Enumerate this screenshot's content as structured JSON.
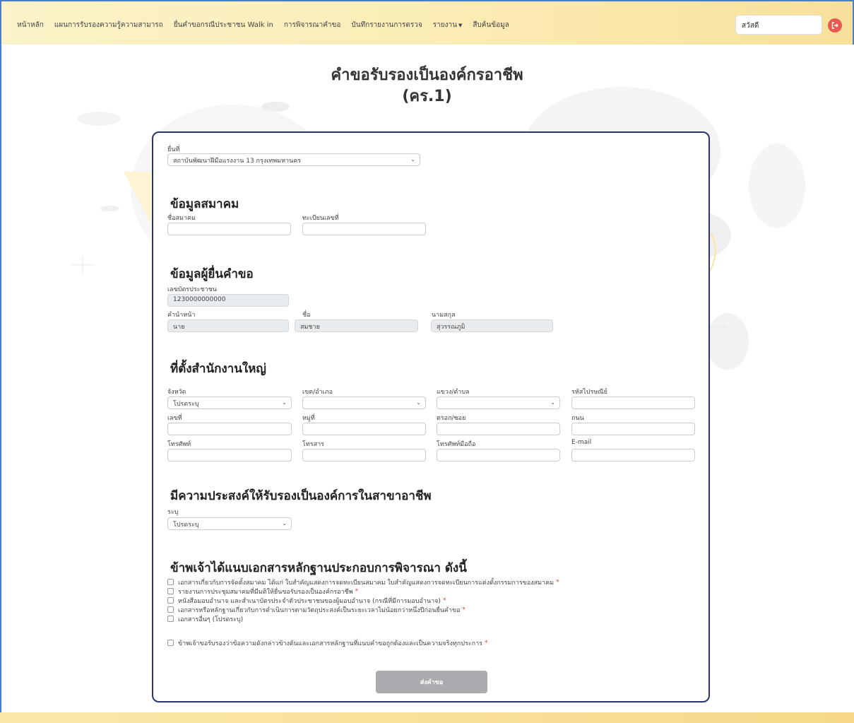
{
  "nav": {
    "links": [
      "หน้าหลัก",
      "แผนการรับรองความรู้ความสามารถ",
      "ยื่นคำขอกรณีประชาชน Walk in",
      "การพิจารณาคำขอ",
      "บันทึกรายงานการตรวจ",
      "รายงาน",
      "สืบค้นข้อมูล"
    ],
    "user_greeting": "สวัสดี"
  },
  "page": {
    "title_line1": "คำขอรับรองเป็นองค์กรอาชีพ",
    "title_line2": "(คร.1)"
  },
  "submit_at": {
    "label": "ยื่นที่",
    "value": "สถาบันพัฒนาฝีมือแรงงาน 13 กรุงเทพมหานคร"
  },
  "association": {
    "title": "ข้อมูลสมาคม",
    "name_label": "ชื่อสมาคม",
    "name_value": "",
    "reg_label": "ทะเบียนเลขที่",
    "reg_value": ""
  },
  "applicant": {
    "title": "ข้อมูลผู้ยื่นคำขอ",
    "id_label": "เลขบัตรประชาชน",
    "id_value": "1230000000000",
    "prefix_label": "คำนำหน้า",
    "prefix_value": "นาย",
    "firstname_label": "ชื่อ",
    "firstname_value": "สมชาย",
    "lastname_label": "นามสกุล",
    "lastname_value": "สุวรรณภูมิ"
  },
  "office": {
    "title": "ที่ตั้งสำนักงานใหญ่",
    "province_label": "จังหวัด",
    "province_value": "โปรดระบุ",
    "district_label": "เขต/อำเภอ",
    "district_value": "",
    "subdistrict_label": "แขวง/ตำบล",
    "subdistrict_value": "",
    "postal_label": "รหัสไปรษณีย์",
    "address_no_label": "เลขที่",
    "moo_label": "หมู่ที่",
    "soi_label": "ตรอก/ซอย",
    "road_label": "ถนน",
    "phone_label": "โทรศัพท์",
    "fax_label": "โทรสาร",
    "mobile_label": "โทรศัพท์มือถือ",
    "email_label": "E-mail"
  },
  "profession": {
    "title": "มีความประสงค์ให้รับรองเป็นองค์การในสาขาอาชีพ",
    "specify_label": "ระบุ",
    "specify_value": "โปรดระบุ"
  },
  "documents": {
    "title": "ข้าพเจ้าได้แนบเอกสารหลักฐานประกอบการพิจารณา ดังนี้",
    "items": [
      {
        "label": "เอกสารเกี่ยวกับการจัดตั้งสมาคม ได้แก่ ใบสำคัญแสดงการจดทะเบียนสมาคม ใบสำคัญแสดงการจดทะเบียนการแต่งตั้งกรรมการของสมาคม",
        "required": "*"
      },
      {
        "label": "รายงานการประชุมสมาคมที่มีมติให้ยื่นขอรับรองเป็นองค์กรอาชีพ",
        "required": "*"
      },
      {
        "label": "หนังสือมอบอำนาจ และสำเนาบัตรประจำตัวประชาชนของผู้มอบอำนาจ (กรณีที่มีการมอบอำนาจ)",
        "required": "*"
      },
      {
        "label": "เอกสารหรือหลักฐานเกี่ยวกับการดำเนินการตามวัตถุประสงค์เป็นระยะเวลาไม่น้อยกว่าหนึ่งปีก่อนยื่นคำขอ",
        "required": "*"
      },
      {
        "label": "เอกสารอื่นๆ (โปรดระบุ)",
        "required": ""
      }
    ],
    "certify_label": "ข้าพเจ้าขอรับรองว่าข้อความดังกล่าวข้างต้นและเอกสารหลักฐานที่แนบคำขอถูกต้องและเป็นความจริงทุกประการ",
    "certify_required": "*"
  },
  "submit_button": "ส่งคำขอ",
  "colors": {
    "navbar_start": "#fbf3c9",
    "navbar_end": "#f8e09b",
    "card_border": "#27376b",
    "required": "#e0403a",
    "button_disabled": "#a9abaf",
    "logout": "#e85a4f"
  }
}
